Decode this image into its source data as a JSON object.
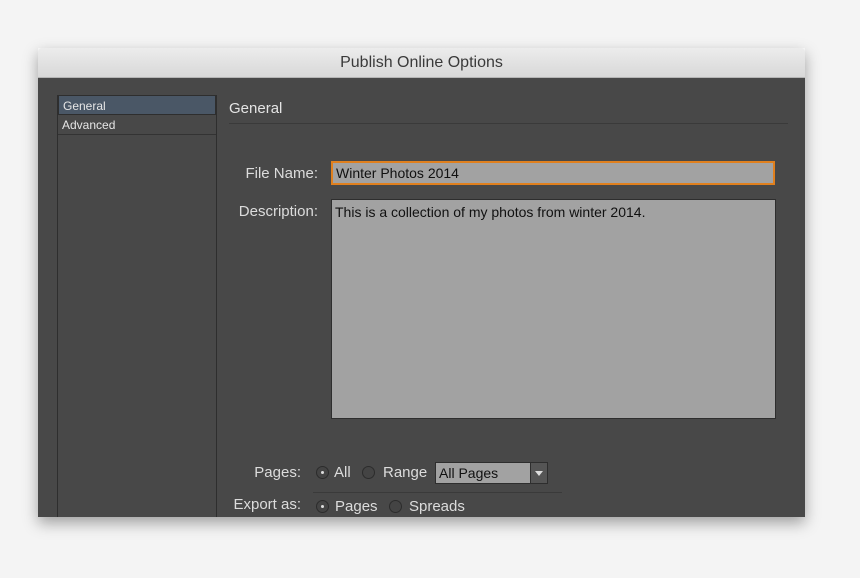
{
  "window": {
    "title": "Publish Online Options"
  },
  "sidebar": {
    "items": [
      {
        "label": "General",
        "selected": true
      },
      {
        "label": "Advanced",
        "selected": false
      }
    ]
  },
  "main": {
    "section_title": "General",
    "file_name_label": "File Name:",
    "file_name_value": "Winter Photos 2014",
    "description_label": "Description:",
    "description_value": "This is a collection of my photos from winter 2014.",
    "pages_label": "Pages:",
    "pages_all": "All",
    "pages_range": "Range",
    "pages_selected": "All",
    "pages_dropdown_value": "All Pages",
    "export_label": "Export as:",
    "export_pages": "Pages",
    "export_spreads": "Spreads",
    "export_selected": "Pages"
  }
}
